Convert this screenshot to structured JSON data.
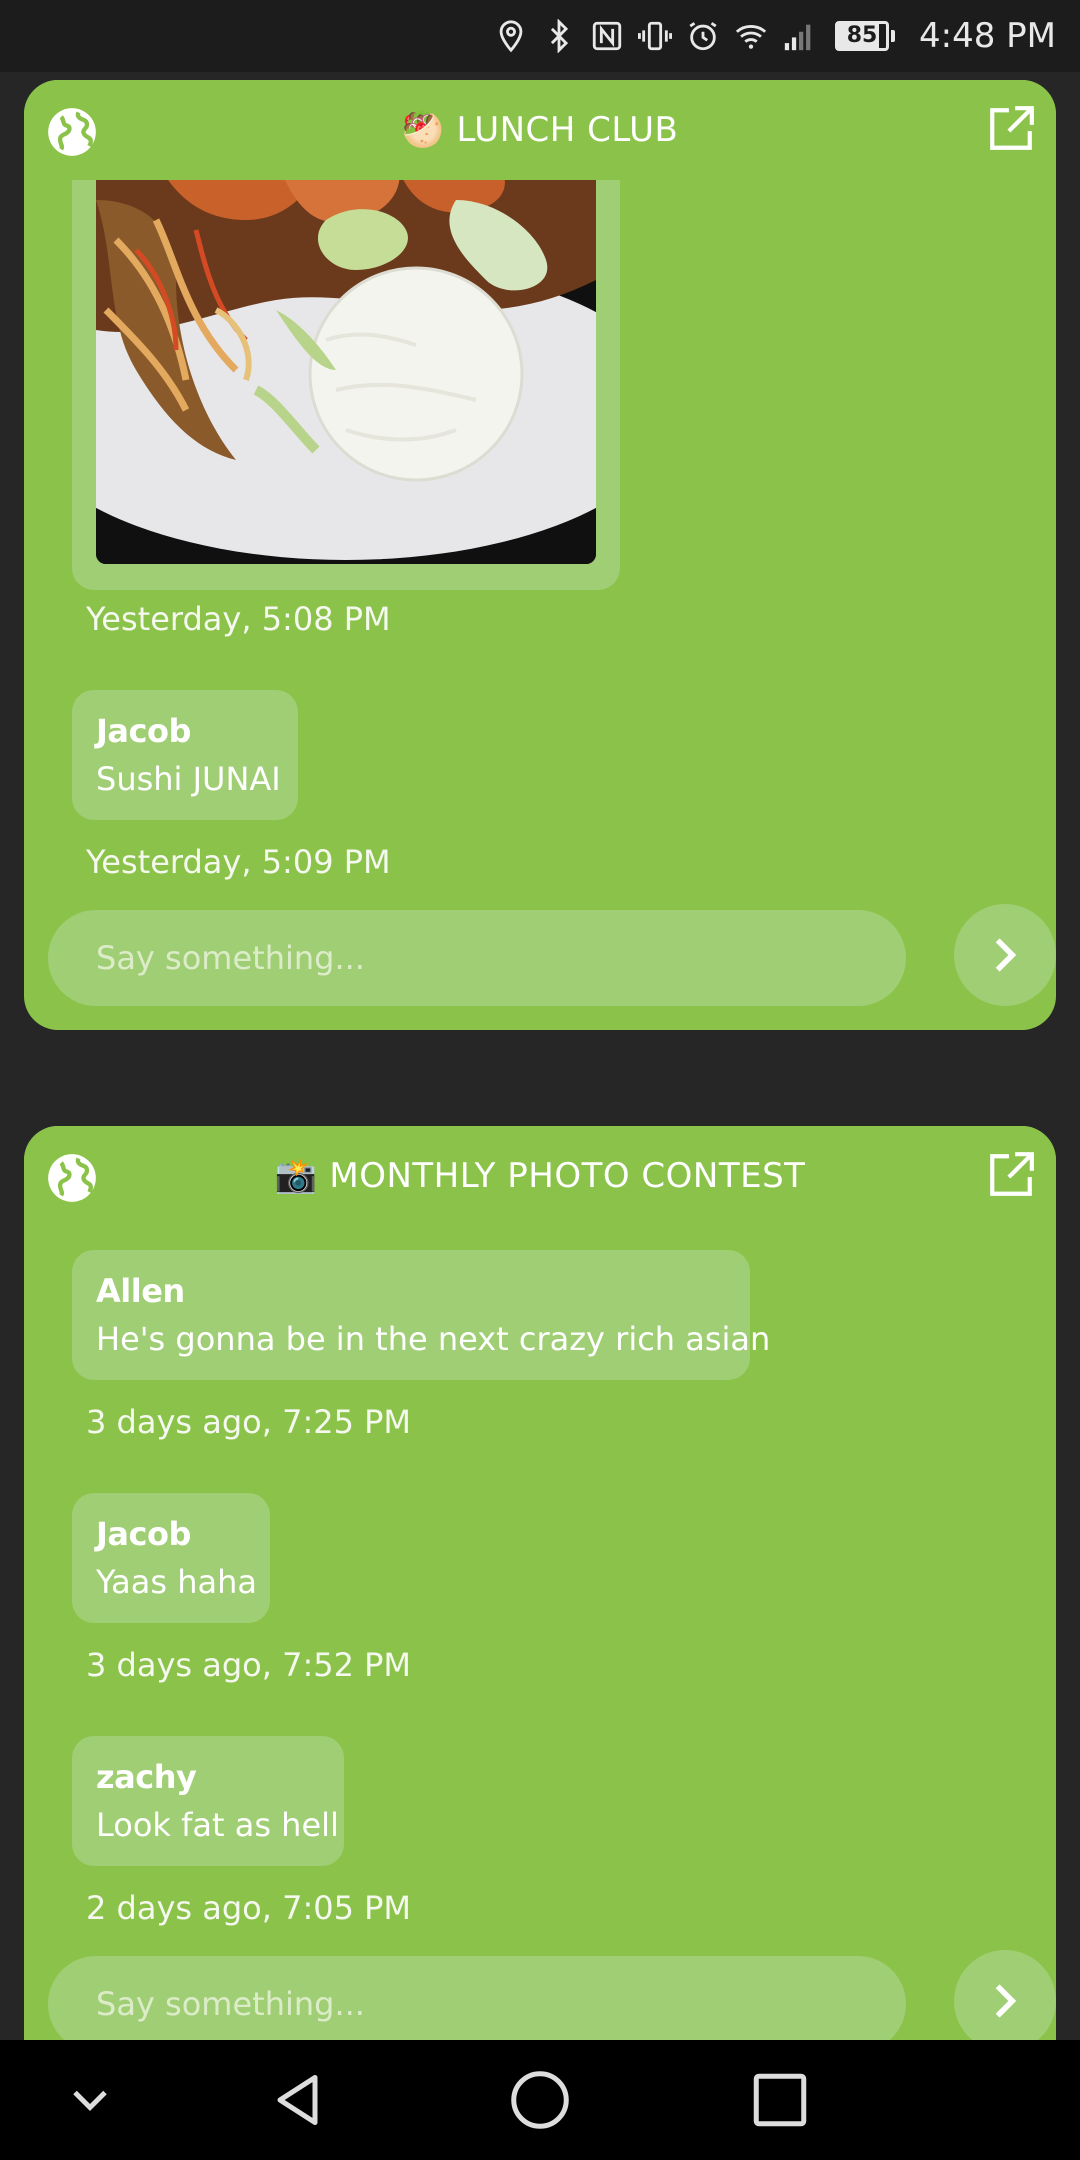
{
  "status_bar": {
    "time": "4:48 PM",
    "battery": "85",
    "icons": [
      "location-icon",
      "bluetooth-icon",
      "nfc-icon",
      "vibrate-icon",
      "alarm-icon",
      "wifi-icon",
      "signal-icon"
    ]
  },
  "cards": [
    {
      "title": "LUNCH CLUB",
      "emoji": "🥙",
      "messages": [
        {
          "type": "photo",
          "timestamp": "Yesterday, 5:08 PM"
        },
        {
          "sender": "Jacob",
          "text": "Sushi JUNAI",
          "timestamp": "Yesterday, 5:09 PM"
        }
      ],
      "input_placeholder": "Say something..."
    },
    {
      "title": "MONTHLY PHOTO CONTEST",
      "emoji": "📸",
      "messages": [
        {
          "sender": "Allen",
          "text": "He's gonna be in the next crazy rich asian",
          "timestamp": "3 days ago, 7:25 PM"
        },
        {
          "sender": "Jacob",
          "text": "Yaas haha",
          "timestamp": "3 days ago, 7:52 PM"
        },
        {
          "sender": "zachy",
          "text": "Look fat as hell",
          "timestamp": "2 days ago, 7:05 PM"
        }
      ],
      "input_placeholder": "Say something..."
    }
  ],
  "colors": {
    "card_bg": "#8bc34a",
    "bubble_bg": "#a0ce74",
    "page_bg": "#262626"
  }
}
